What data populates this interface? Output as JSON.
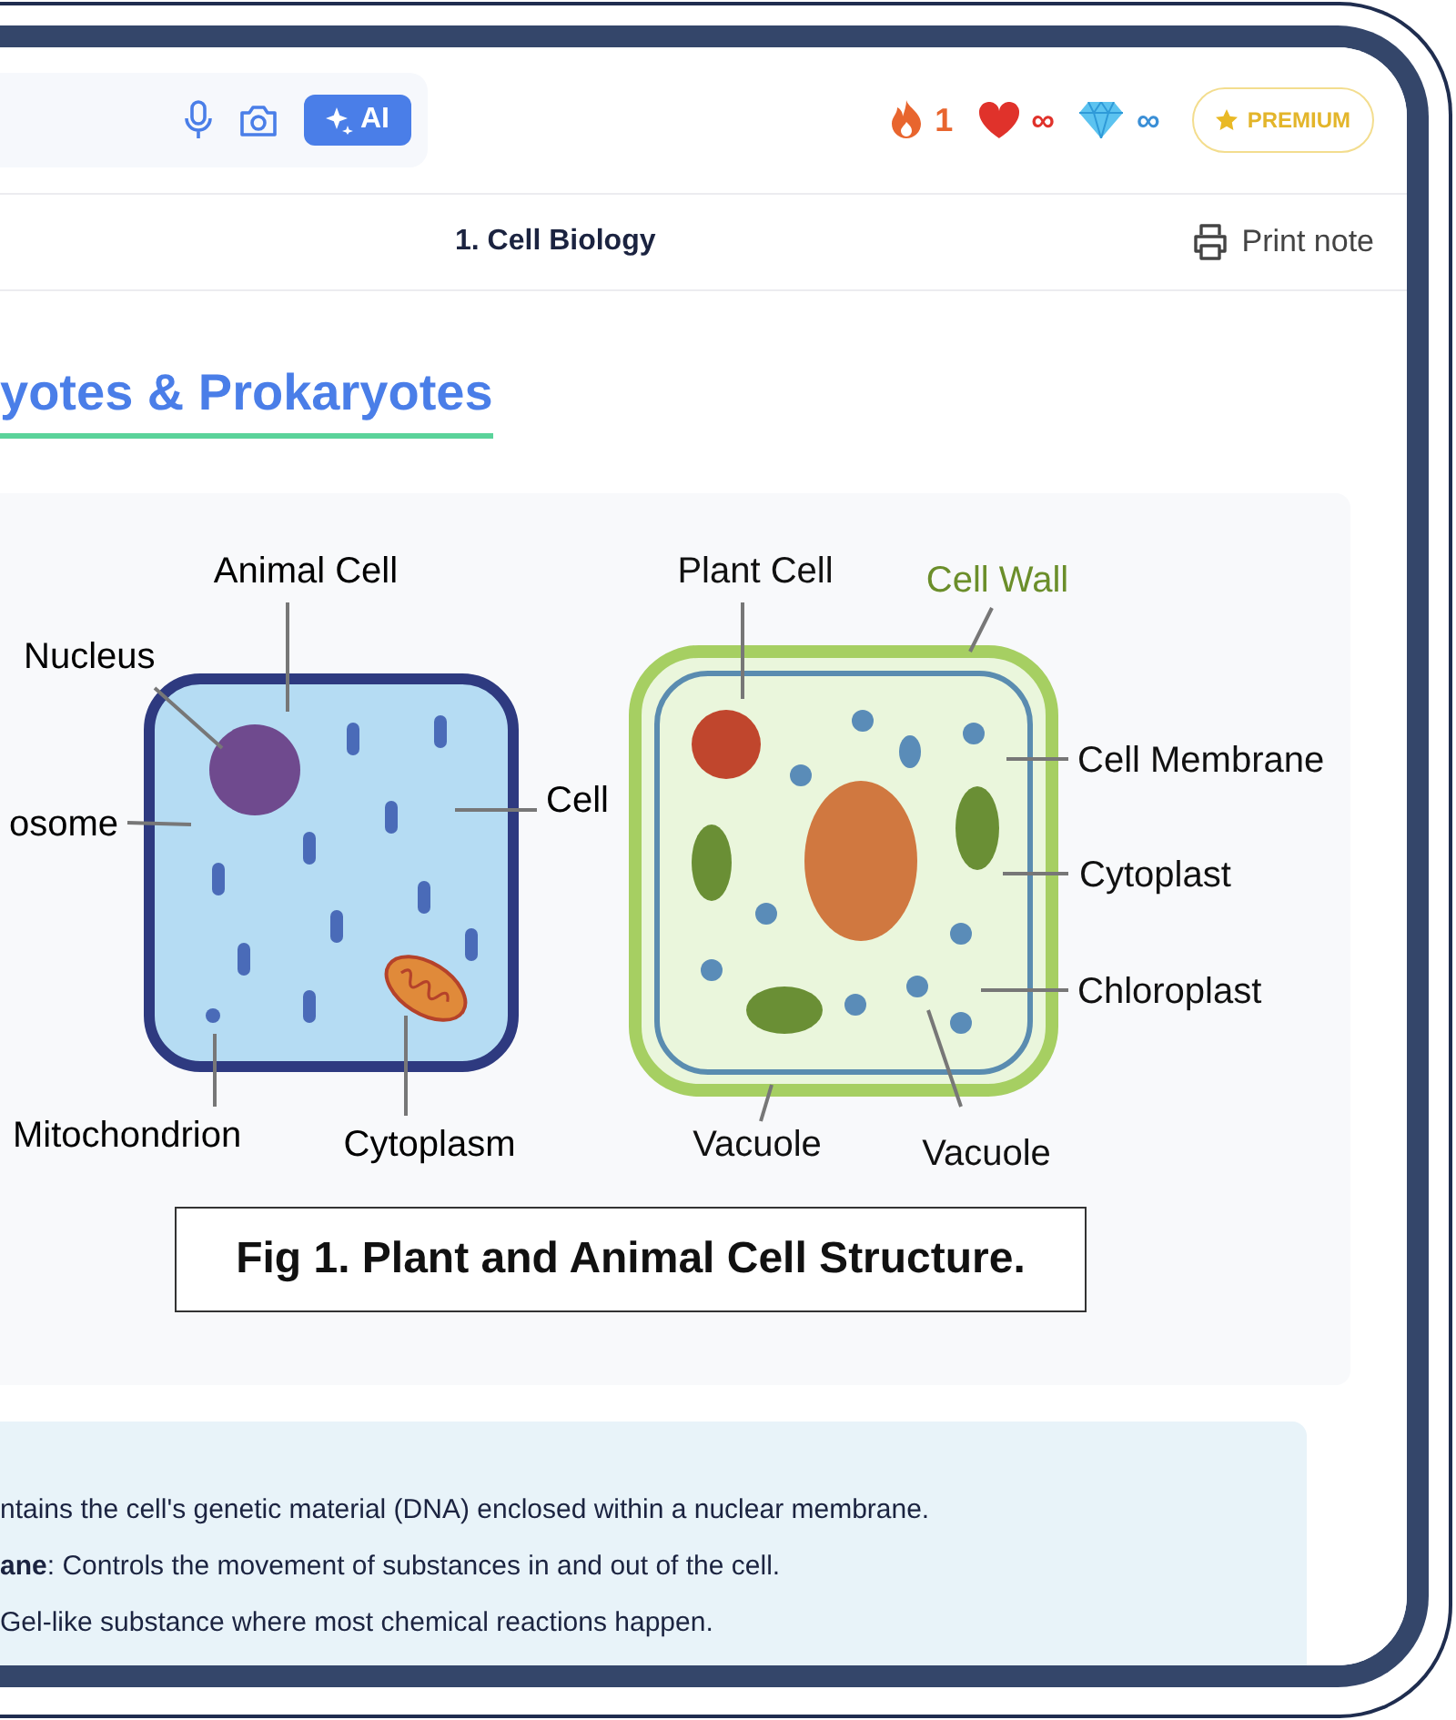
{
  "toolbar": {
    "ai_button": "AI",
    "stats": [
      {
        "kind": "streak",
        "value": "1"
      },
      {
        "kind": "hearts",
        "value": "∞"
      },
      {
        "kind": "gems",
        "value": "∞"
      }
    ],
    "premium_button": "PREMIUM"
  },
  "header": {
    "title": "1. Cell Biology",
    "print_button": "Print note"
  },
  "section_heading": "yotes & Prokaryotes",
  "figure": {
    "animal_labels": [
      "Animal Cell",
      "Nucleus",
      "osome",
      "Cell",
      "Mitochondrion",
      "Cytoplasm"
    ],
    "plant_labels": [
      "Plant Cell",
      "Cell Wall",
      "Cell Membrane",
      "Cytoplast",
      "Chloroplast",
      "Vacuole",
      "Vacuole"
    ],
    "caption": "Fig 1. Plant and Animal Cell Structure."
  },
  "notes": [
    "ntains the cell's genetic material (DNA) enclosed within a nuclear membrane.",
    "**ane**: Controls the movement of substances in and out of the cell.",
    "Gel-like substance where most chemical reactions happen."
  ]
}
